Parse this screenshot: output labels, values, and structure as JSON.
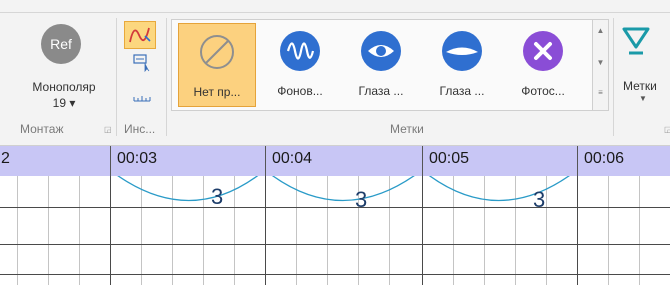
{
  "ribbon": {
    "montage": {
      "ref_label": "Ref",
      "mono_label": "Монополяр",
      "mono_value": "19 ▾",
      "group_label": "Монтаж"
    },
    "tools": {
      "group_label": "Инс..."
    },
    "markers": {
      "group_label": "Метки",
      "items": [
        {
          "label": "Нет пр...",
          "icon": "none-icon",
          "selected": true
        },
        {
          "label": "Фонов...",
          "icon": "wave-icon",
          "color": "#2f6fd0"
        },
        {
          "label": "Глаза ...",
          "icon": "eye-open-icon",
          "color": "#2f6fd0"
        },
        {
          "label": "Глаза ...",
          "icon": "eye-closed-icon",
          "color": "#2f6fd0"
        },
        {
          "label": "Фотос...",
          "icon": "photo-stimulation-icon",
          "color": "#8a4dd6"
        }
      ]
    },
    "metki_button": {
      "label": "Метки",
      "icon": "marker-triangle-icon",
      "color": "#1a9aa8"
    }
  },
  "timeline": {
    "left_partial": "2",
    "ticks": [
      "00:03",
      "00:04",
      "00:05",
      "00:06"
    ],
    "background": "#c8c6f5"
  },
  "chart": {
    "markers": [
      "3",
      "3",
      "3"
    ],
    "curve_color": "#2a9bc8"
  }
}
